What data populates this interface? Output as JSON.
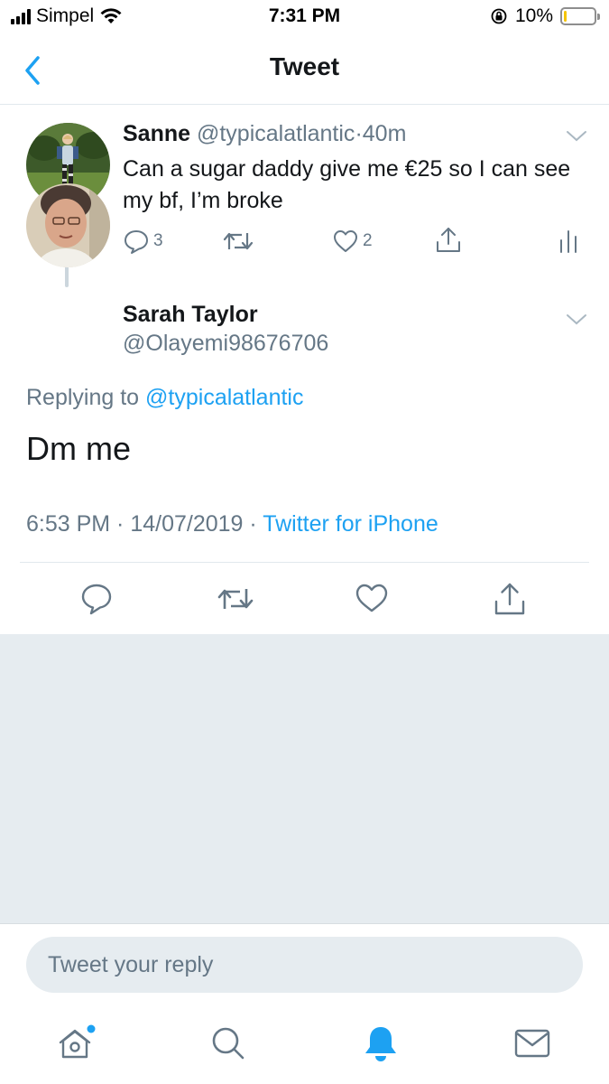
{
  "status_bar": {
    "carrier": "Simpel",
    "time": "7:31 PM",
    "battery_percent": "10%",
    "battery_level": 0.1
  },
  "nav": {
    "title": "Tweet",
    "back_icon": "chevron-left-icon"
  },
  "parent_tweet": {
    "name": "Sanne",
    "handle": "@typicalatlantic",
    "separator": "·",
    "age": "40m",
    "text": "Can a sugar daddy give me €25 so I can see my bf, I’m broke",
    "reply_count": "3",
    "like_count": "2"
  },
  "main_tweet": {
    "name": "Sarah Taylor",
    "handle": "@Olayemi98676706",
    "replying_prefix": "Replying to ",
    "replying_to": "@typicalatlantic",
    "text": "Dm me",
    "timestamp": "6:53 PM · 14/07/2019 · ",
    "source": "Twitter for iPhone"
  },
  "reply_bar": {
    "placeholder": "Tweet your reply"
  },
  "tab_bar": {
    "items": [
      "home-icon",
      "search-icon",
      "notifications-icon",
      "messages-icon"
    ]
  },
  "colors": {
    "accent": "#1da1f2",
    "secondary_text": "#657786",
    "divider": "#e1e8ed",
    "gray_background": "#e6ecf0"
  }
}
